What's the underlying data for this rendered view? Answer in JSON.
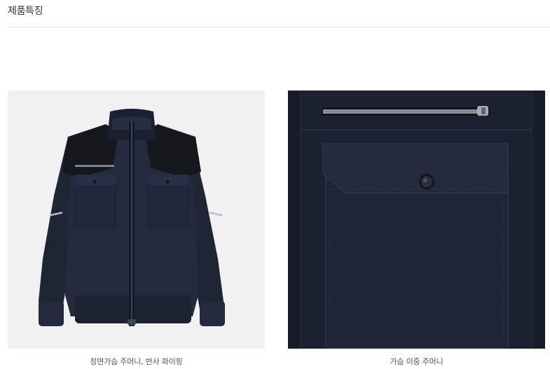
{
  "section": {
    "title": "제품특징"
  },
  "features": [
    {
      "caption": "정면가슴 주머니, 반사 파이핑",
      "image": "jacket-front-photo"
    },
    {
      "caption": "가슴 이중 주머니",
      "image": "chest-pocket-closeup-photo"
    }
  ],
  "colors": {
    "jacket_navy": "#1e2535",
    "shoulder_black": "#15171c",
    "photo_background": "#f1f1f1",
    "divider": "#e2e2e2"
  }
}
